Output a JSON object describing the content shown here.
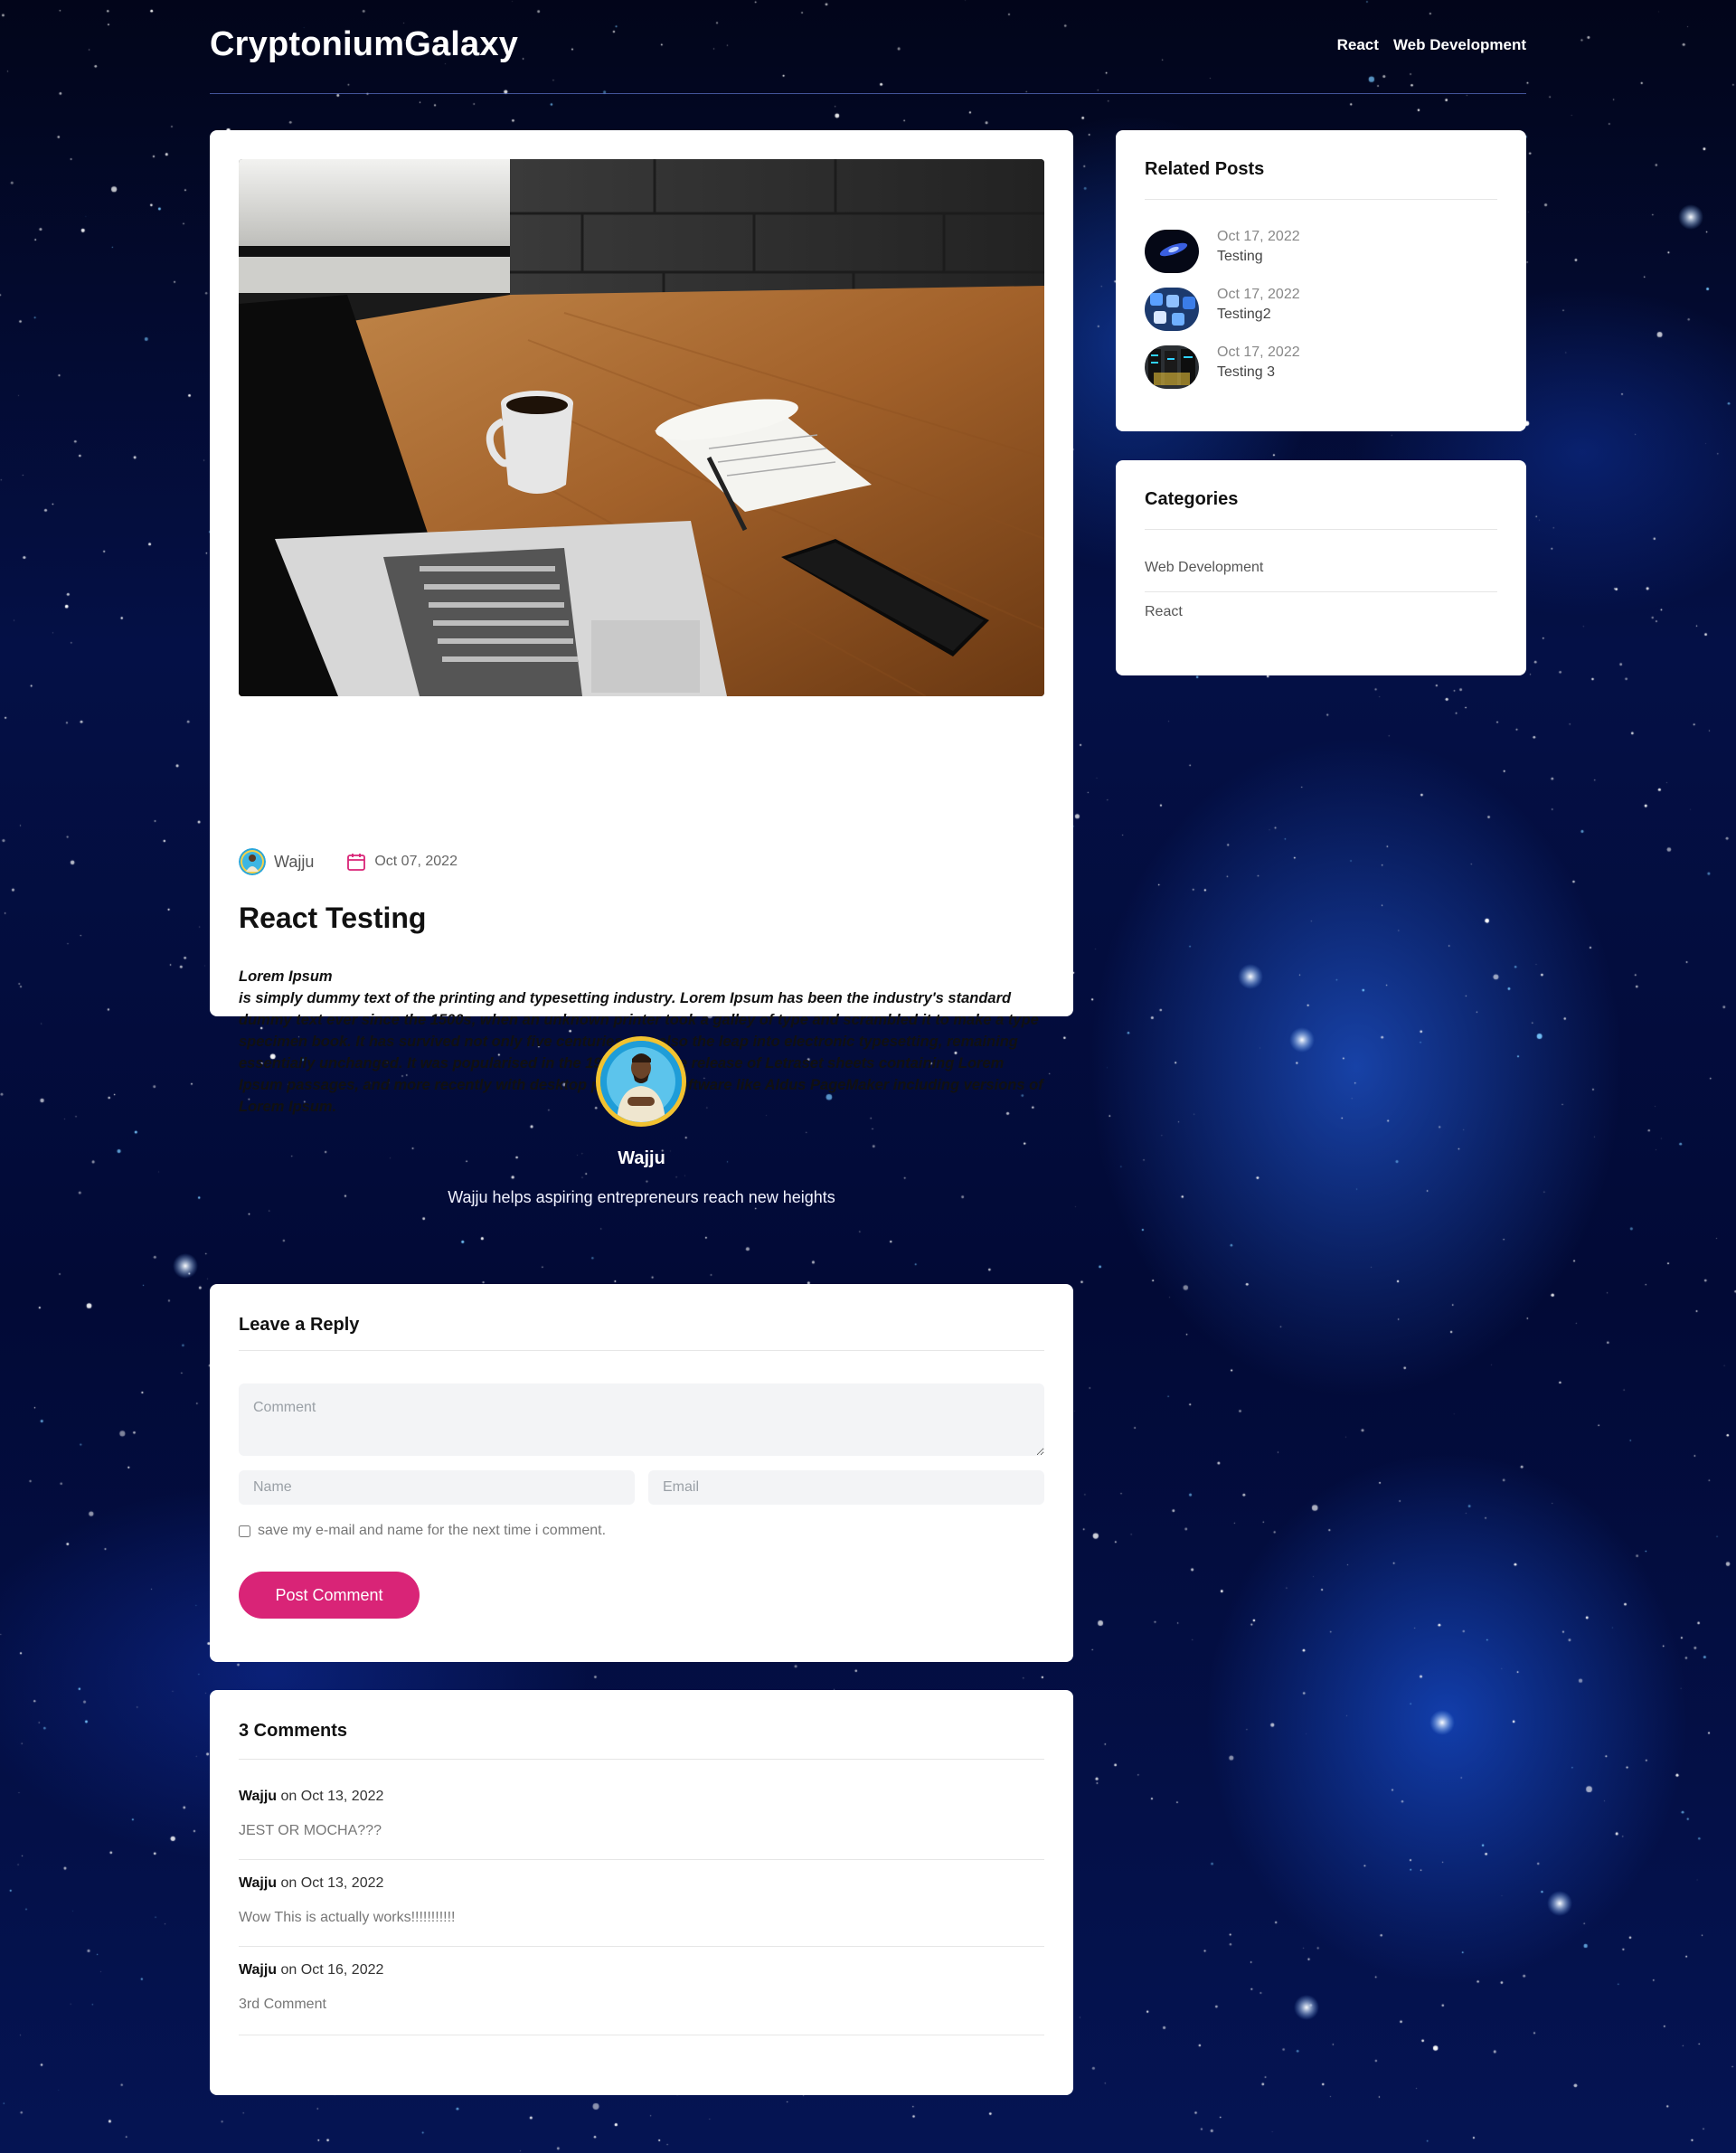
{
  "site": {
    "logo": "CryptoniumGalaxy"
  },
  "nav": {
    "items": [
      "React",
      "Web Development"
    ]
  },
  "post": {
    "author": "Wajju",
    "date": "Oct 07, 2022",
    "title": "React Testing",
    "body_lead": "Lorem Ipsum",
    "body": "is simply dummy text of the printing and typesetting industry. Lorem Ipsum has been the industry's standard dummy text ever since the 1500s, when an unknown printer took a galley of type and scrambled it to make a type specimen book. It has survived not only five centuries, but also the leap into electronic typesetting, remaining essentially unchanged. It was popularised in the 1960s with the release of Letraset sheets containing Lorem Ipsum passages, and more recently with desktop publishing software like Aldus PageMaker including versions of Lorem Ipsum."
  },
  "author_box": {
    "name": "Wajju",
    "bio": "Wajju helps aspiring entrepreneurs reach new heights"
  },
  "reply": {
    "title": "Leave a Reply",
    "comment_placeholder": "Comment",
    "name_placeholder": "Name",
    "email_placeholder": "Email",
    "save_label": "save my e-mail and name for the next time i comment.",
    "submit_label": "Post Comment"
  },
  "comments": {
    "title": "3 Comments",
    "items": [
      {
        "author": "Wajju",
        "date": "on Oct 13, 2022",
        "text": "JEST OR MOCHA???"
      },
      {
        "author": "Wajju",
        "date": "on Oct 13, 2022",
        "text": "Wow This is actually works!!!!!!!!!!!"
      },
      {
        "author": "Wajju",
        "date": "on Oct 16, 2022",
        "text": "3rd Comment"
      }
    ]
  },
  "related": {
    "title": "Related Posts",
    "items": [
      {
        "date": "Oct 17, 2022",
        "title": "Testing"
      },
      {
        "date": "Oct 17, 2022",
        "title": "Testing2"
      },
      {
        "date": "Oct 17, 2022",
        "title": "Testing 3"
      }
    ]
  },
  "categories": {
    "title": "Categories",
    "items": [
      "Web Development",
      "React"
    ]
  },
  "colors": {
    "accent": "#d92477",
    "card": "#ffffff",
    "background": "#041046",
    "avatar_ring": "#f2c230"
  }
}
